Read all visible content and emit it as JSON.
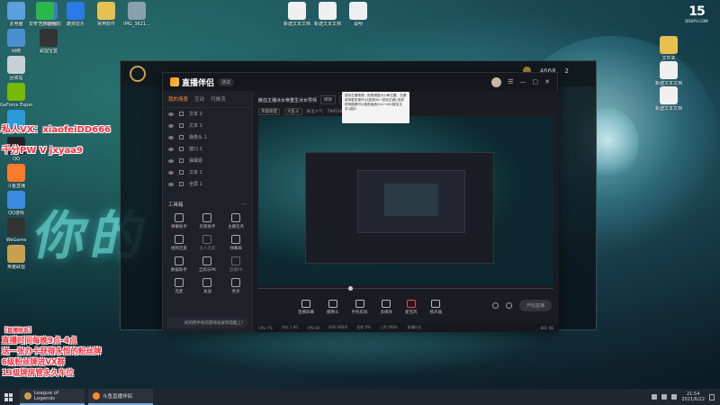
{
  "desktop_left_icons": [
    {
      "label": "此电脑",
      "color": "#5aa0e0"
    },
    {
      "label": "网络",
      "color": "#4a90d0"
    },
    {
      "label": "回收站",
      "color": "#c8d0d8"
    },
    {
      "label": "GeForce Experience",
      "color": "#76b900"
    },
    {
      "label": "Microsoft Edge",
      "color": "#2b9ad8"
    },
    {
      "label": "QQ",
      "color": "#222"
    },
    {
      "label": "斗鱼直播",
      "color": "#ff7a2a"
    },
    {
      "label": "QQ游戏",
      "color": "#3a8ae0"
    },
    {
      "label": "WeGame",
      "color": "#333"
    },
    {
      "label": "英雄联盟",
      "color": "#c8a050"
    },
    {
      "label": "控制面板",
      "color": "#3a7ac8"
    },
    {
      "label": "联盟宝盒",
      "color": "#333"
    }
  ],
  "desktop_top_icons": [
    {
      "label": "爱奇艺万能播放器",
      "color": "#2bb84a"
    },
    {
      "label": "酷狗音乐",
      "color": "#2a7ae8"
    },
    {
      "label": "常用软件",
      "color": "#e8c050"
    },
    {
      "label": "IMG_3621...",
      "color": "#8aa0b0"
    }
  ],
  "desktop_right_icons": [
    {
      "label": "新建文本文档",
      "color": "#f0f0f0"
    },
    {
      "label": "新建文本文档",
      "color": "#f0f0f0"
    },
    {
      "label": "说明",
      "color": "#f0f0f0"
    },
    {
      "label": "文件夹",
      "color": "#e8c050"
    },
    {
      "label": "新建文本文档",
      "color": "#f0f0f0"
    },
    {
      "label": "新建文本文档",
      "color": "#f0f0f0"
    }
  ],
  "overlay_text": {
    "contact_line1": "私人VX：xiaofeiDD666",
    "contact_line2": "千分PW V jxyaa9",
    "notice_title": "【直播联系】",
    "notice_lines": [
      "直播时间每晚9点-4点",
      "送一张办卡获得永恒的粉丝牌",
      "6级粉丝牌进VX群",
      "13级牌房管永久车位"
    ]
  },
  "wallpaper_text": "你的",
  "watermark": {
    "big": "15",
    "small": "DOUYU.COM"
  },
  "lol_window": {
    "currency_1": "4668",
    "top_label": "2"
  },
  "live_app": {
    "title": "直播伴侣",
    "version": "测试",
    "left_tabs": [
      "我的场景",
      "互动",
      "可推流"
    ],
    "scenes": [
      "文本 2",
      "文本 1",
      "摄像头 1",
      "窗口 1",
      "弹幕姬",
      "文本 1",
      "全屏 1"
    ],
    "tools_title": "工具箱",
    "tools_more": "⋯",
    "tools": [
      {
        "label": "弹幕助手",
        "dim": false
      },
      {
        "label": "房管助手",
        "dim": false
      },
      {
        "label": "主播任务",
        "dim": false
      },
      {
        "label": "视频连麦",
        "dim": false
      },
      {
        "label": "多人连麦",
        "dim": true
      },
      {
        "label": "弹幕屏",
        "dim": false
      },
      {
        "label": "数据助手",
        "dim": false
      },
      {
        "label": "全民乐PK",
        "dim": false
      },
      {
        "label": "直播PK",
        "dim": true
      },
      {
        "label": "连麦",
        "dim": false
      },
      {
        "label": "发送",
        "dim": false
      },
      {
        "label": "更多",
        "dim": false
      }
    ],
    "bottom_hint": "如何把手机的游戏投屏到电脑上?",
    "stream_title": "献血主播冰女帝重生冰女导师",
    "btn_change": "修改",
    "btn_share": "分享",
    "category": "英雄联盟",
    "meta_category": "英雄联盟",
    "meta_game": "大乱斗",
    "meta_fans_label": "关注人气",
    "meta_fans": "7995186",
    "meta_online": "12",
    "meta_other": "8",
    "tooltip": "鼠标左键拖拽，拖拽调整大小和位置。右键菜单更多操作(比如按Alt+鼠标左键)(或其他快捷键可以裁剪画面)Ctrl+Alt(增加文本)/图片",
    "controls": [
      {
        "label": "直播屏幕",
        "kind": "normal"
      },
      {
        "label": "摄像头",
        "kind": "normal"
      },
      {
        "label": "手机投屏",
        "kind": "normal"
      },
      {
        "label": "多媒体",
        "kind": "normal"
      },
      {
        "label": "麦克风",
        "kind": "mic"
      },
      {
        "label": "扬声器",
        "kind": "normal"
      }
    ],
    "go_live": "开始直播",
    "status": [
      "CPU 7%",
      "内存 1.8G",
      "FPS 60",
      "码率 0KB/S",
      "丢帧 0%",
      "上传 0KB/s",
      "直播时长"
    ],
    "stats_right": "661 KB"
  },
  "taskbar": {
    "items": [
      {
        "label": "League of Legends",
        "color": "#c8a050"
      },
      {
        "label": "斗鱼直播伴侣",
        "color": "#ff8a2a"
      }
    ],
    "time": "21:54",
    "date": "2021/6/22"
  }
}
